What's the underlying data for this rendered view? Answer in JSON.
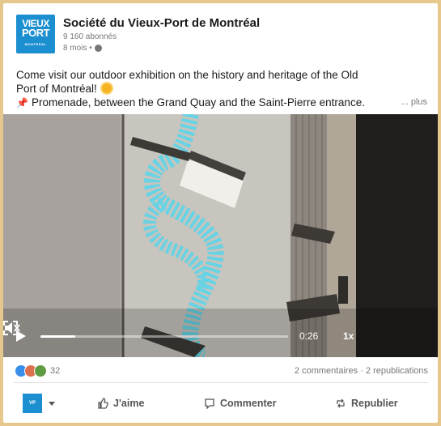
{
  "header": {
    "org_name": "Société du Vieux-Port de Montréal",
    "followers": "9 160 abonnés",
    "time_ago": "8 mois •",
    "logo": {
      "line1": "VIEUX",
      "line2": "PORT",
      "line3": "MONTRÉAL"
    }
  },
  "post": {
    "line1": "Come visit our outdoor exhibition on the history and heritage of the Old",
    "line2": "Port of Montréal!",
    "line3": "Promenade, between the Grand Quay and the Saint-Pierre entrance.",
    "more": "... plus"
  },
  "video": {
    "time": "0:26",
    "speed": "1x",
    "progress": 0.14
  },
  "social": {
    "reaction_count": "32",
    "stats": "2 commentaires · 2 republications"
  },
  "actions": {
    "like": "J'aime",
    "comment": "Commenter",
    "repost": "Republier"
  },
  "colors": {
    "brand": "#1c8fd0",
    "frame": "#e6c88c"
  },
  "icons": [
    "globe-icon",
    "sun-emoji-icon",
    "pin-emoji-icon",
    "play-icon",
    "mute-icon",
    "fullscreen-icon",
    "like-icon",
    "comment-icon",
    "repost-icon",
    "chevron-down-icon"
  ]
}
